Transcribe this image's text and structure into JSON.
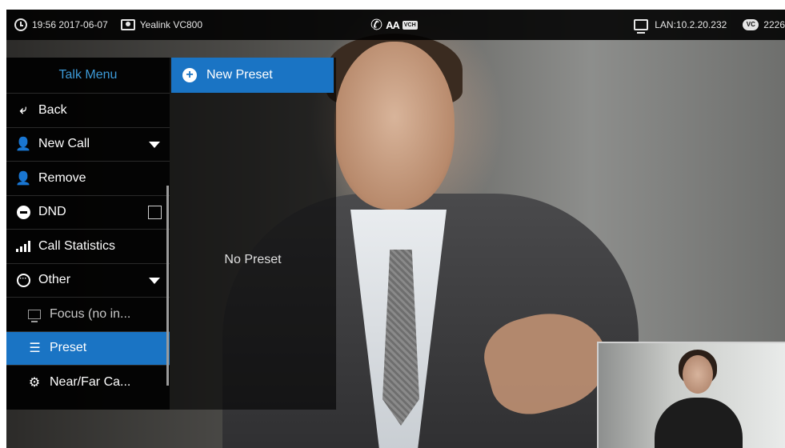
{
  "status_bar": {
    "time_date": "19:56 2017-06-07",
    "device_name": "Yealink VC800",
    "font_icon_text": "AA",
    "vch_icon_text": "VCH",
    "lan": "LAN:10.2.20.232",
    "vc_icon_text": "VC",
    "vc_number": "2226"
  },
  "talk_menu": {
    "title": "Talk Menu",
    "items": [
      {
        "label": "Back",
        "icon": "back-arrow-icon"
      },
      {
        "label": "New Call",
        "icon": "add-user-icon",
        "has_dropdown": true
      },
      {
        "label": "Remove",
        "icon": "remove-user-icon"
      },
      {
        "label": "DND",
        "icon": "minus-circle-icon",
        "checked": false
      },
      {
        "label": "Call Statistics",
        "icon": "signal-bars-icon"
      },
      {
        "label": "Other",
        "icon": "dots-circle-icon",
        "has_dropdown": true
      },
      {
        "label": "Focus (no in...",
        "icon": "focus-icon",
        "sub": true
      },
      {
        "label": "Preset",
        "icon": "preset-icon",
        "sub": true,
        "selected": true
      },
      {
        "label": "Near/Far Ca...",
        "icon": "camera-gear-icon",
        "sub": true
      }
    ]
  },
  "preset_panel": {
    "new_preset_label": "New Preset",
    "empty_text": "No Preset"
  },
  "colors": {
    "accent": "#1a74c4",
    "menu_title": "#3d9ad8"
  }
}
